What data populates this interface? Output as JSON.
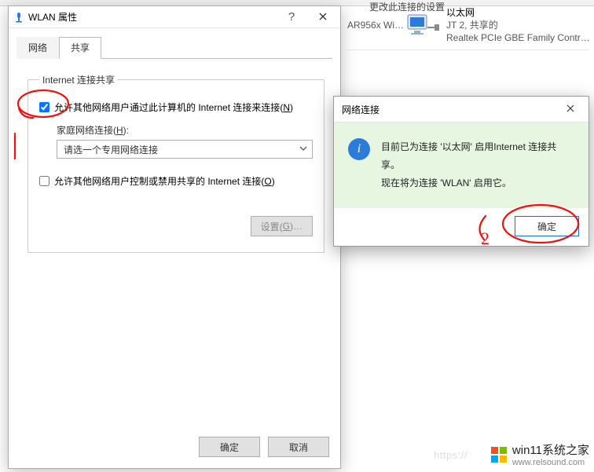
{
  "bg_change_text": "更改此连接的设置",
  "wlan_dialog": {
    "title": "WLAN 属性",
    "help_char": "?",
    "tabs": {
      "net": "网络",
      "share": "共享"
    },
    "group_legend": "Internet 连接共享",
    "cb_allow": "允许其他网络用户通过此计算机的 Internet 连接来连接(",
    "cb_allow_hot": "N",
    "cb_allow_end": ")",
    "home_label_pre": "家庭网络连接(",
    "home_label_hot": "H",
    "home_label_end": "):",
    "select_value": "请选一个专用网络连接",
    "cb_ctrl": "允许其他网络用户控制或禁用共享的 Internet 连接(",
    "cb_ctrl_hot": "O",
    "cb_ctrl_end": ")",
    "settings_btn_pre": "设置(",
    "settings_btn_hot": "G",
    "settings_btn_end": ")…",
    "ok": "确定",
    "cancel": "取消"
  },
  "adapters": {
    "header": "",
    "a1": {
      "name_line": "",
      "sub": "AR956x Wi…"
    },
    "a2": {
      "name": "以太网",
      "sub1": "JT 2, 共享的",
      "sub2": "Realtek PCIe GBE Family Contr…"
    }
  },
  "popup": {
    "title": "网络连接",
    "line1": "目前已为连接 '以太网' 启用Internet 连接共享。",
    "line2": "现在将为连接 'WLAN' 启用它。",
    "ok": "确定"
  },
  "annot": {
    "one_label": "",
    "two_label": "2"
  },
  "watermark": {
    "big": "win11系统之家",
    "site": "www.relsound.com"
  },
  "https_ghost": "https://"
}
